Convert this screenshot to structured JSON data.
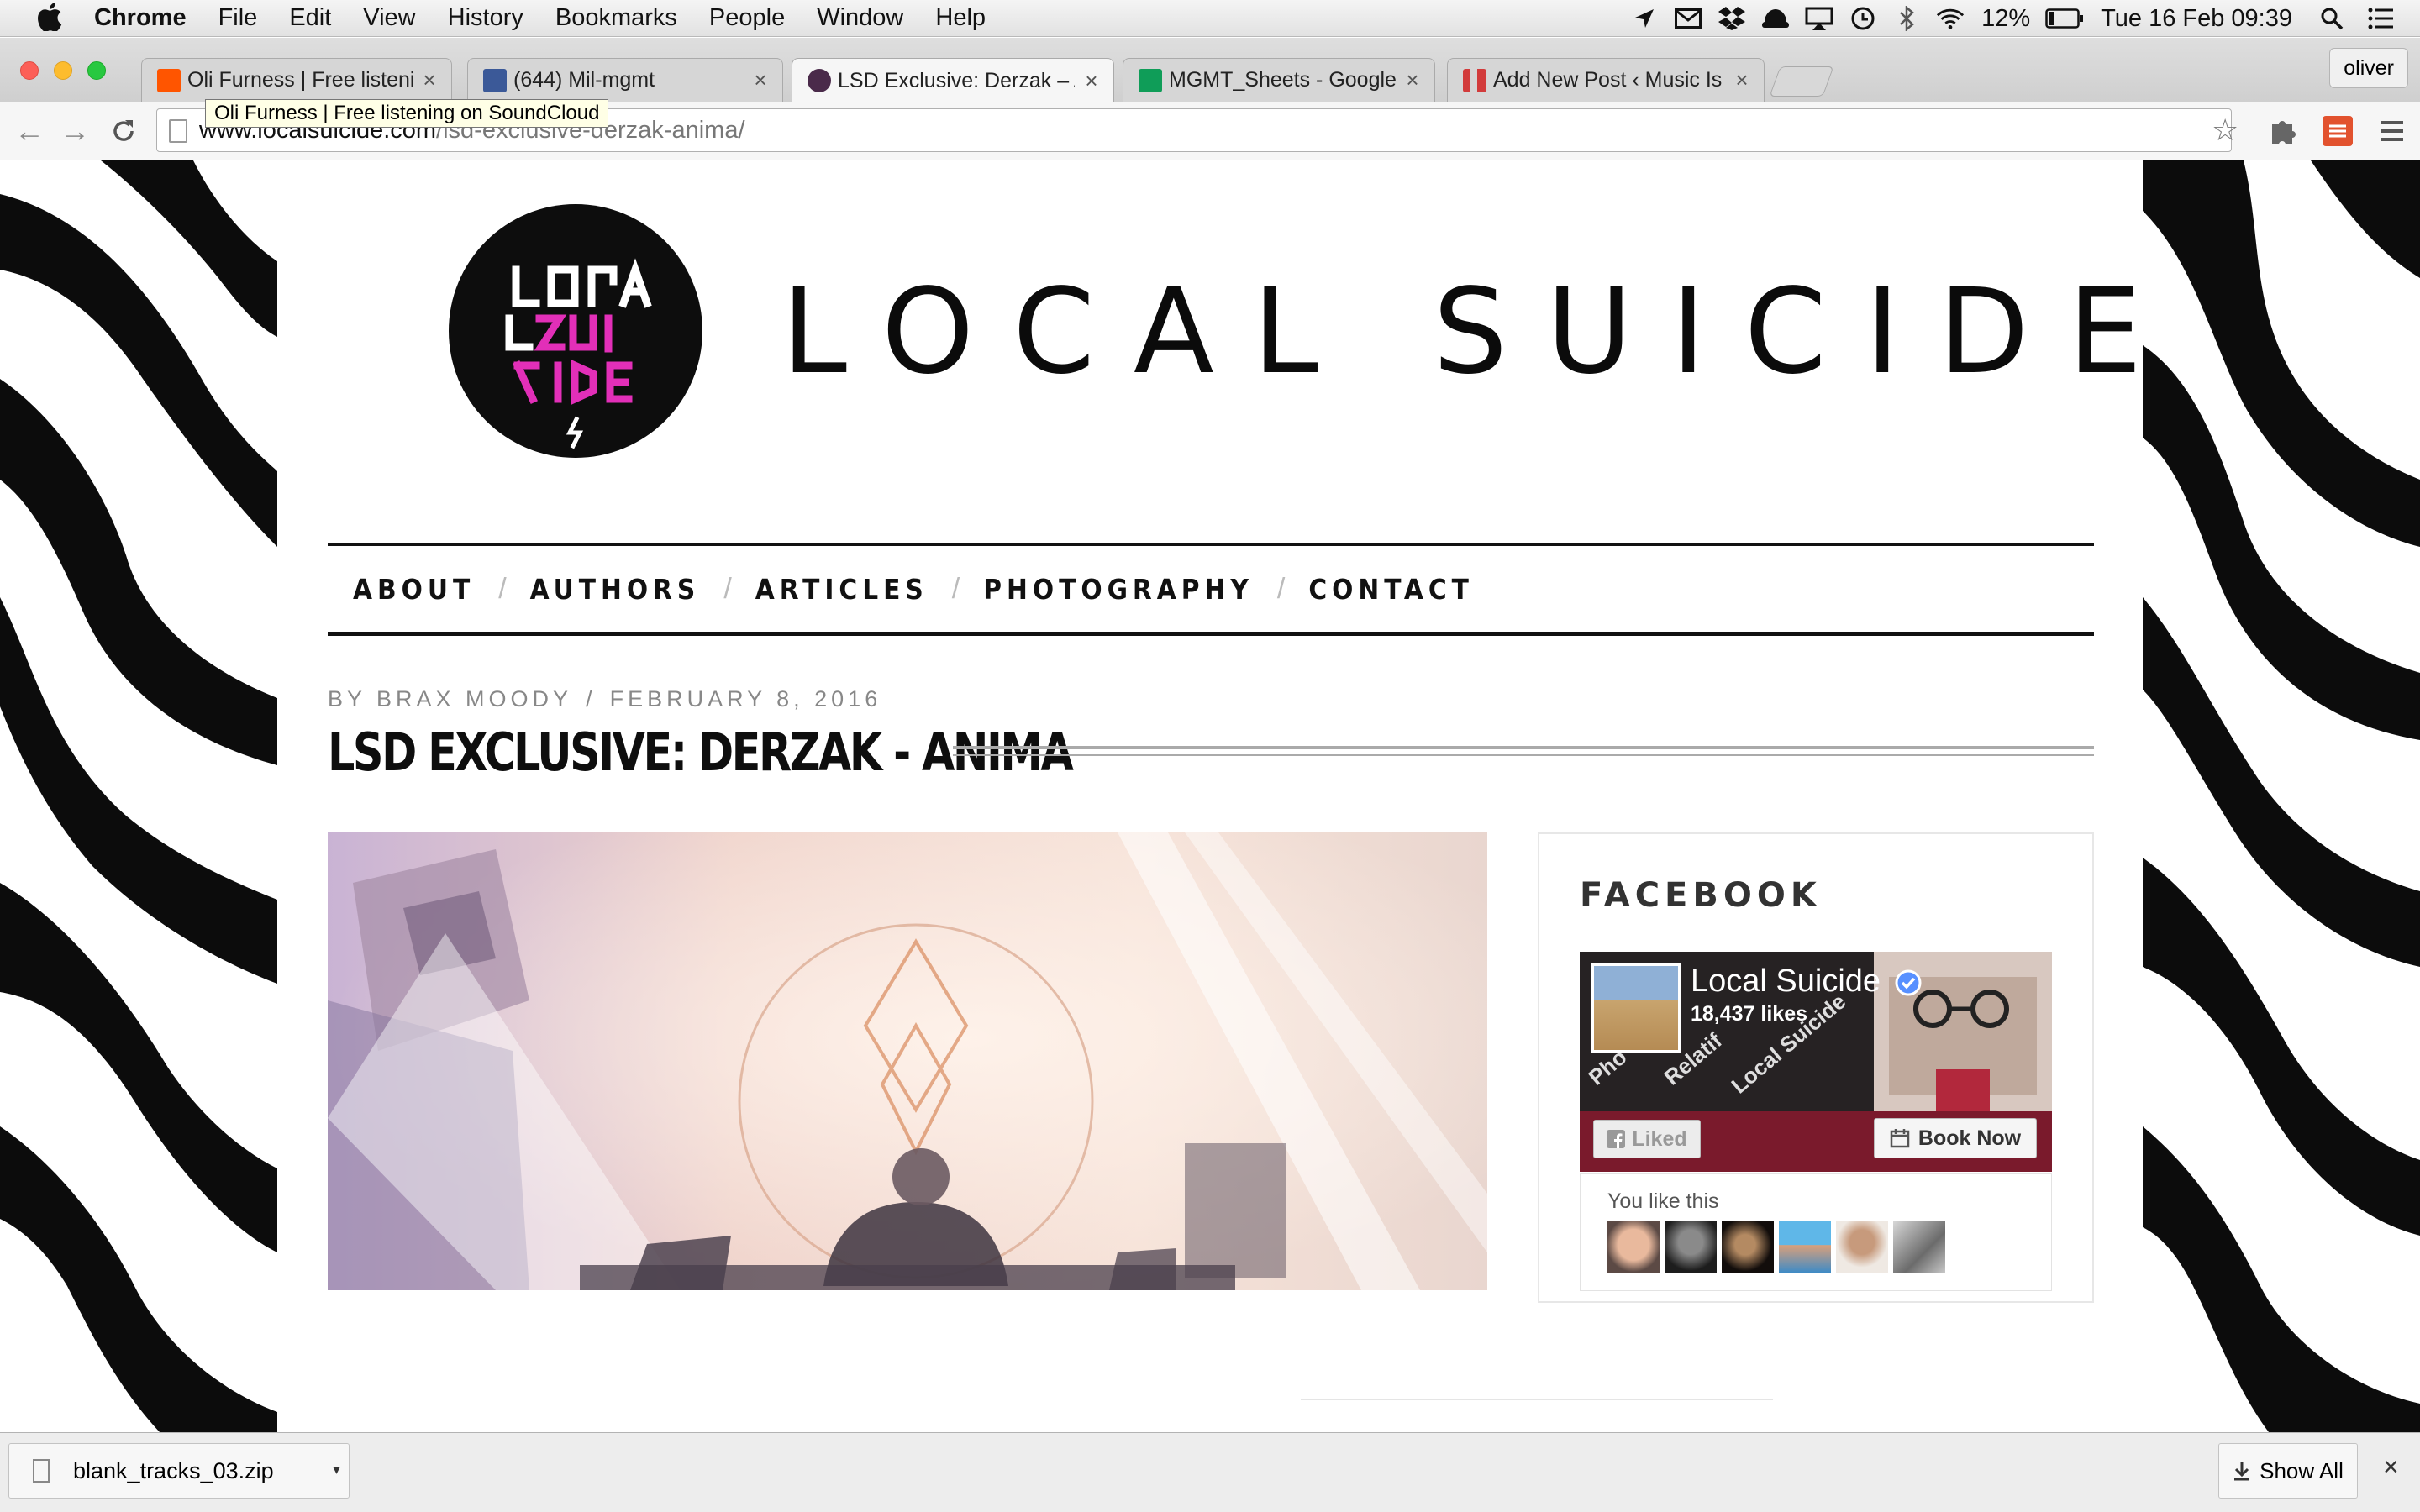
{
  "menubar": {
    "apple": "",
    "app": "Chrome",
    "items": [
      "File",
      "Edit",
      "View",
      "History",
      "Bookmarks",
      "People",
      "Window",
      "Help"
    ],
    "battery": "12%",
    "datetime": "Tue 16 Feb  09:39"
  },
  "tabs": [
    {
      "title": "Oli Furness | Free listening",
      "favicon_color": "#ff5500"
    },
    {
      "title": "(644) Mil-mgmt",
      "favicon_color": "#3b5998"
    },
    {
      "title": "LSD Exclusive: Derzak – Ar",
      "favicon_color": "#4a2a4a"
    },
    {
      "title": "MGMT_Sheets - Google Sh",
      "favicon_color": "#0f9d58"
    },
    {
      "title": "Add New Post ‹ Music Is L",
      "favicon_color": "#d23b3b"
    }
  ],
  "profile": "oliver",
  "tooltip": "Oli Furness | Free listening on SoundCloud",
  "address": {
    "domain": "www.localsuicide.com",
    "path": "/lsd-exclusive-derzak-anima/"
  },
  "site": {
    "logo_text": [
      "LOCA",
      "LSUI",
      "CIDE"
    ],
    "title": "LOCAL SUICIDE"
  },
  "nav": [
    "ABOUT",
    "AUTHORS",
    "ARTICLES",
    "PHOTOGRAPHY",
    "CONTACT"
  ],
  "post": {
    "author": "BY BRAX MOODY",
    "separator": "/",
    "date": "FEBRUARY 8, 2016",
    "title": "LSD EXCLUSIVE: DERZAK - ANIMA"
  },
  "sidebar": {
    "widget_title": "FACEBOOK",
    "page_name": "Local Suicide",
    "likes": "18,437 likes",
    "liked_label": "Liked",
    "book_label": "Book Now",
    "you_like": "You like this"
  },
  "downloads": {
    "file": "blank_tracks_03.zip",
    "show_all": "Show All"
  },
  "colors": {
    "logo_magenta": "#e22fb8",
    "logo_bg": "#0d0d0d",
    "fb_cover_red": "#7a1a2c"
  }
}
